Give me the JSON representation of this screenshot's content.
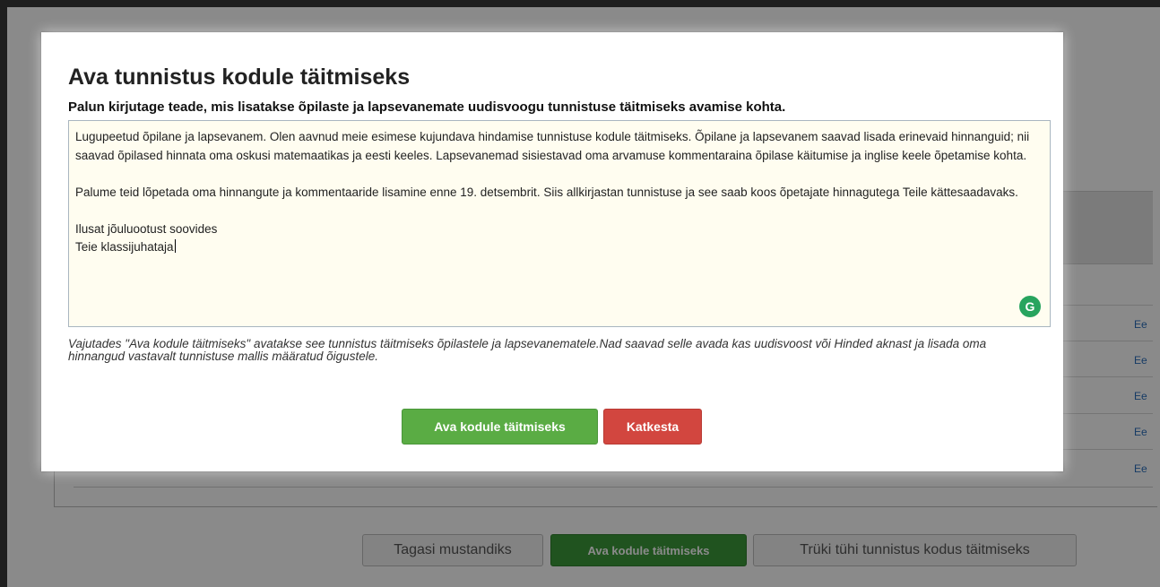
{
  "background_page": {
    "row_links": [
      "Ee",
      "Ee",
      "Ee",
      "Ee",
      "Ee"
    ],
    "footer_buttons": {
      "back_to_draft": "Tagasi mustandiks",
      "open_for_home": "Ava kodule täitmiseks",
      "print_blank": "Trüki tühi tunnistus kodus täitmiseks"
    }
  },
  "modal": {
    "title": "Ava tunnistus kodule täitmiseks",
    "subtitle": "Palun kirjutage teade, mis lisatakse õpilaste ja lapsevanemate uudisvoogu tunnistuse täitmiseks avamise kohta.",
    "message": {
      "paragraph1": "Lugupeetud õpilane ja lapsevanem. Olen aavnud meie esimese kujundava hindamise tunnistuse kodule täitmiseks. Õpilane ja lapsevanem saavad lisada erinevaid hinnanguid; nii saavad  õpilased hinnata oma oskusi matemaatikas ja eesti keeles. Lapsevanemad sisiestavad oma arvamuse kommentaraina õpilase käitumise ja inglise keele õpetamise kohta.",
      "paragraph2": "Palume teid lõpetada oma hinnangute ja kommentaaride lisamine enne 19. detsembrit. Siis allkirjastan tunnistuse ja see saab koos õpetajate hinnagutega Teile kättesaadavaks.",
      "closing_line1": "Ilusat jõuluootust soovides",
      "closing_line2": "Teie klassijuhataja"
    },
    "grammarly_icon_glyph": "G",
    "note": "Vajutades \"Ava kodule täitmiseks\" avatakse see tunnistus täitmiseks õpilastele ja lapsevanematele.Nad saavad selle avada kas uudisvoost või Hinded aknast ja lisada oma hinnangud vastavalt tunnistuse mallis määratud õigustele.",
    "confirm_label": "Ava kodule täitmiseks",
    "cancel_label": "Katkesta"
  },
  "colors": {
    "confirm_button": "#5aac44",
    "cancel_button": "#d2463f",
    "textarea_background": "#fffdf0",
    "grammarly_icon": "#27a45e"
  }
}
